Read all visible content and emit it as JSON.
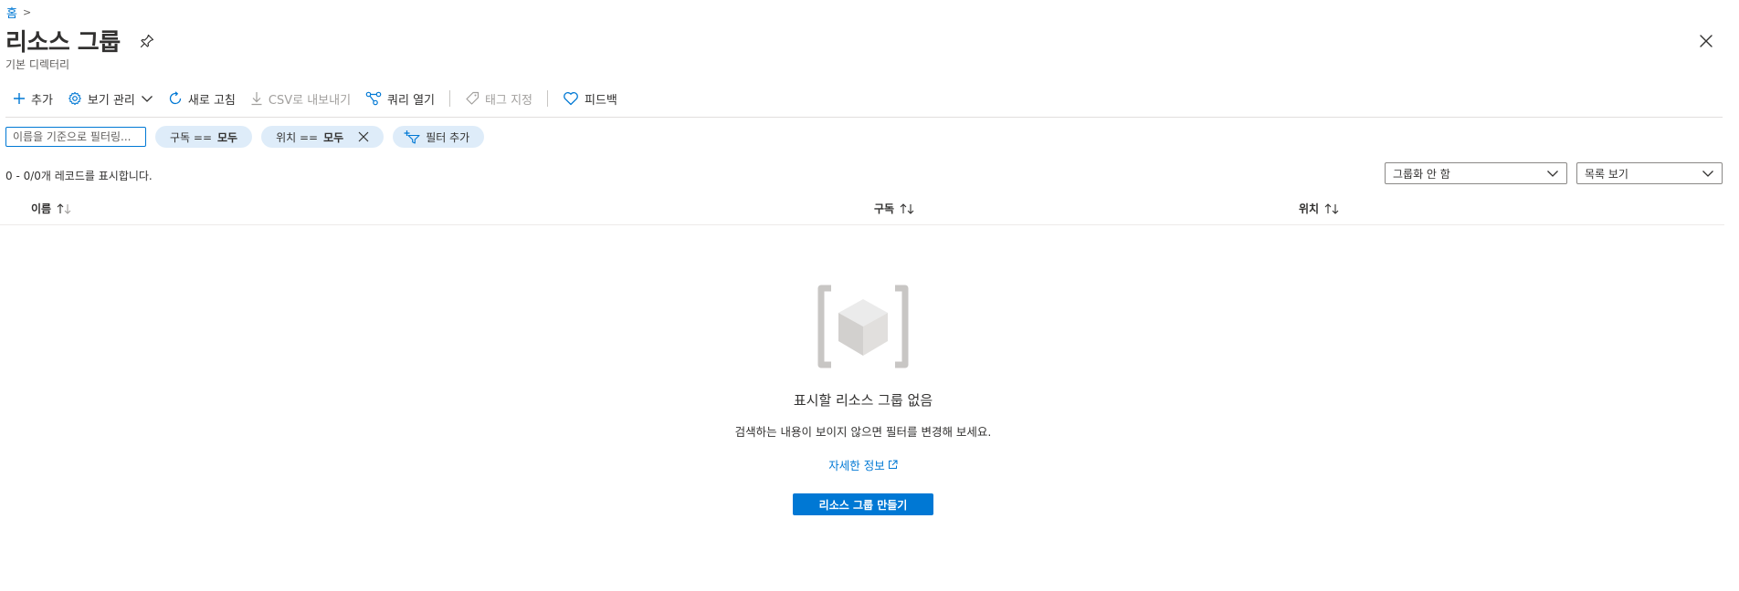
{
  "breadcrumb": {
    "home": "홈",
    "separator": ">"
  },
  "header": {
    "title": "리소스 그룹",
    "subtitle": "기본 디렉터리"
  },
  "toolbar": {
    "add": "추가",
    "manage_view": "보기 관리",
    "refresh": "새로 고침",
    "export_csv": "CSV로 내보내기",
    "open_query": "쿼리 열기",
    "assign_tags": "태그 지정",
    "feedback": "피드백"
  },
  "filters": {
    "search_placeholder": "이름을 기준으로 필터링...",
    "subscription_label": "구독 == ",
    "subscription_value": "모두",
    "location_label": "위치 == ",
    "location_value": "모두",
    "add_filter": "필터 추가"
  },
  "records_text": "0 - 0/0개 레코드를 표시합니다.",
  "grouping": {
    "selected": "그룹화 안 함"
  },
  "view_mode": {
    "selected": "목록 보기"
  },
  "table": {
    "columns": [
      "이름",
      "구독",
      "위치"
    ]
  },
  "empty_state": {
    "title": "표시할 리소스 그룹 없음",
    "description": "검색하는 내용이 보이지 않으면 필터를 변경해 보세요.",
    "learn_more": "자세한 정보",
    "create_button": "리소스 그룹 만들기"
  },
  "colors": {
    "accent": "#0078d4",
    "pill_bg": "#deecf9",
    "text": "#323130",
    "disabled": "#a19f9d"
  },
  "icons": {
    "add": "plus-icon",
    "manage_view": "gear-icon",
    "refresh": "refresh-icon",
    "export_csv": "download-icon",
    "open_query": "query-icon",
    "assign_tags": "tag-icon",
    "feedback": "heart-icon",
    "pin": "pin-icon",
    "close": "close-icon"
  }
}
